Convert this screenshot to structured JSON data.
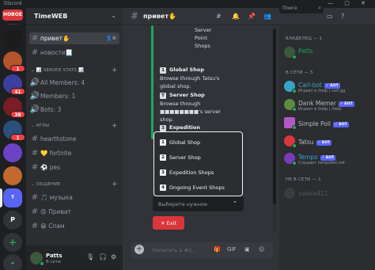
{
  "window": {
    "title": "Discord",
    "controls": "— ▢ ✕"
  },
  "servers": [
    {
      "label": "НОВОЕ",
      "color": "#da373c"
    },
    {
      "label": "",
      "color": "#1c1c1c"
    },
    {
      "label": "",
      "color": "#b5542a",
      "badge": "1"
    },
    {
      "label": "",
      "color": "#3a3fa0",
      "badge": "41"
    },
    {
      "label": "",
      "color": "#7a1d24",
      "badge": "38"
    },
    {
      "label": "",
      "color": "#2b4f7a",
      "badge": "1"
    },
    {
      "label": "",
      "color": "#6b43c4"
    },
    {
      "label": "",
      "color": "#c1692e"
    },
    {
      "label": "T",
      "color": "#5865f2"
    },
    {
      "label": "P",
      "color": "#313338"
    },
    {
      "label": "+",
      "color": "#313338"
    },
    {
      "label": "⌖",
      "color": "#313338"
    }
  ],
  "sidebar": {
    "server_name": "TimeWEB",
    "channels_top": [
      {
        "name": "привет✋",
        "active": true
      },
      {
        "name": "новости📃",
        "active": false
      }
    ],
    "stats_category": "📊 SERVER STATS 📊",
    "stats": [
      {
        "name": "All Members: 4"
      },
      {
        "name": "Members: 1"
      },
      {
        "name": "Bots: 3"
      }
    ],
    "games_category": "ИГРЫ",
    "games": [
      {
        "name": "hearthstone"
      },
      {
        "name": "💛 fortnite"
      },
      {
        "name": "⚽ pes"
      }
    ],
    "chat_category": "ОБЩЕНИЕ",
    "chat": [
      {
        "name": "🎵 музыка"
      },
      {
        "name": "😡 Приват"
      },
      {
        "name": "😁 Спам"
      }
    ]
  },
  "user_panel": {
    "name": "Patts",
    "status": "В сети"
  },
  "header": {
    "channel": "привет✋",
    "search_placeholder": "Поиск"
  },
  "message": {
    "pre_lines": [
      "Server",
      "Point",
      "Shops"
    ],
    "items": [
      {
        "num": "1",
        "title": "Global Shop",
        "desc": "Browse through Tatsu's global shop."
      },
      {
        "num": "T",
        "title": "Server Shop",
        "desc": "Browse through ■■■■■■■■'s server shop."
      },
      {
        "num": "3",
        "title": "Expedition",
        "desc": ""
      }
    ],
    "options": [
      {
        "num": "1",
        "label": "Global Shop"
      },
      {
        "num": "2",
        "label": "Server Shop"
      },
      {
        "num": "3",
        "label": "Expedition Shops"
      },
      {
        "num": "4",
        "label": "Ongoing Event Shops"
      }
    ],
    "select_placeholder": "Выберите нужное",
    "exit_label": "✕  Exit"
  },
  "composer": {
    "placeholder": "Написать в #п..."
  },
  "members": {
    "owner_category": "ВЛАДЕЛЕЦ — 1",
    "owner": [
      {
        "name": "Patts",
        "color": "#23a55a"
      }
    ],
    "online_category": "В СЕТИ — 5",
    "online": [
      {
        "name": "Carl-bot",
        "bot": "✓ БОТ",
        "activity": "Играет в /help | carl.gg",
        "color": "#3ba3c9"
      },
      {
        "name": "Dank Memer",
        "bot": "✓ БОТ",
        "activity": "Играет в /help | /help",
        "color": "#5e8b3d"
      },
      {
        "name": "Simple Poll",
        "bot": "✓ БОТ",
        "activity": "",
        "color": "#b058c7"
      },
      {
        "name": "Tatsu",
        "bot": "✓ БОТ",
        "activity": "",
        "color": "#da373c"
      },
      {
        "name": "Tempo",
        "bot": "✓ БОТ",
        "activity": "Слушает tempobot.net",
        "color": "#7a3bb8"
      }
    ],
    "offline_category": "НЕ В СЕТИ — 1",
    "offline": [
      {
        "name": "valera421",
        "color": "#555860"
      }
    ]
  }
}
